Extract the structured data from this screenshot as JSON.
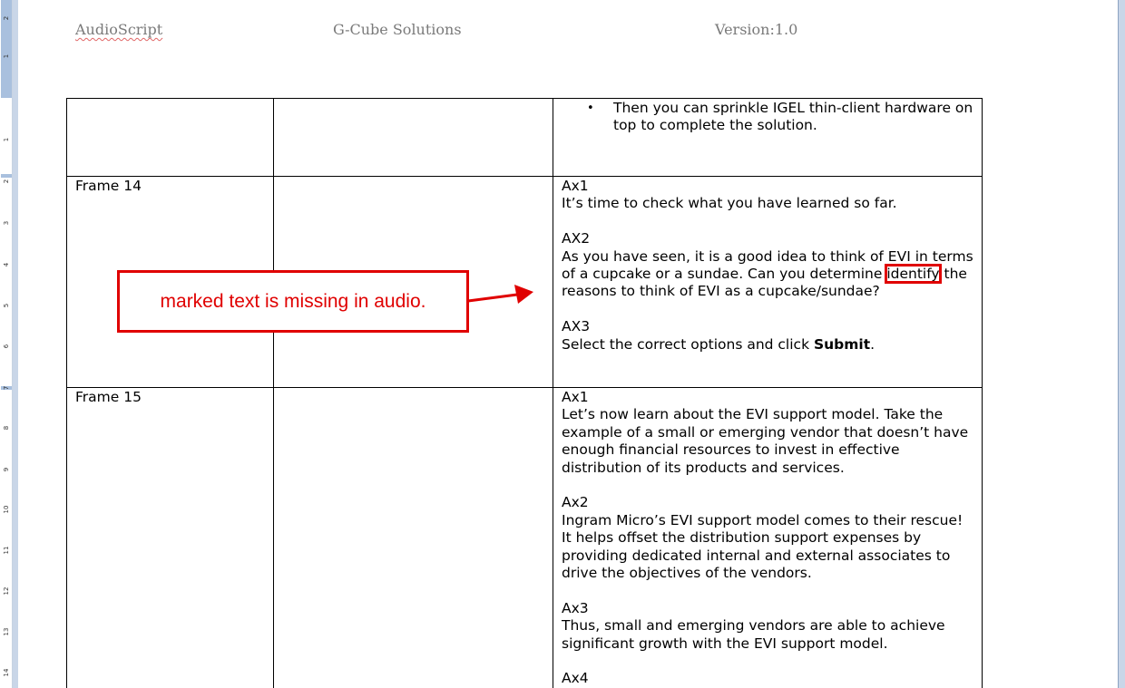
{
  "header": {
    "left": "AudioScript",
    "middle": "G-Cube Solutions",
    "right": "Version:1.0"
  },
  "ruler": {
    "numbers": [
      "2",
      "1",
      "1",
      "2",
      "3",
      "4",
      "5",
      "6",
      "7",
      "8",
      "9",
      "10",
      "11",
      "12",
      "13",
      "14"
    ]
  },
  "table": {
    "row1": {
      "col1": "",
      "col2": "",
      "bullet": "Then you can sprinkle IGEL thin-client hardware on top to complete the solution."
    },
    "row2": {
      "frame": "Frame 14",
      "col2": "",
      "ax1_label": "Ax1",
      "ax1_text": "It’s time to check what you have learned so far.",
      "ax2_label": "AX2",
      "ax2_text_a": "As you have seen, it is a good idea to think of EVI in terms of a cupcake or a sundae. Can you determine",
      "ax2_marked": "identify",
      "ax2_text_b": "the reasons to think of EVI as a cupcake/sundae?",
      "ax3_label": "AX3",
      "ax3_text_a": "Select the correct options and click",
      "ax3_bold": "Submit",
      "ax3_text_b": "."
    },
    "row3": {
      "frame": "Frame 15",
      "col2": "",
      "ax1_label": "Ax1",
      "ax1_text": "Let’s now learn about the EVI support model. Take the example of a small or emerging vendor that doesn’t have enough financial resources to invest in effective distribution of its products and services.",
      "ax2_label": "Ax2",
      "ax2_text": "Ingram Micro’s EVI support model comes to their rescue! It helps offset the distribution support expenses by providing dedicated internal and external associates to drive the objectives of the vendors.",
      "ax3_label": "Ax3",
      "ax3_text": "Thus, small and emerging vendors are able to achieve significant growth with the EVI support model.",
      "ax4_label": "Ax4"
    }
  },
  "annotation": {
    "callout_text": "marked text is missing in audio.",
    "color": "#e00000"
  }
}
